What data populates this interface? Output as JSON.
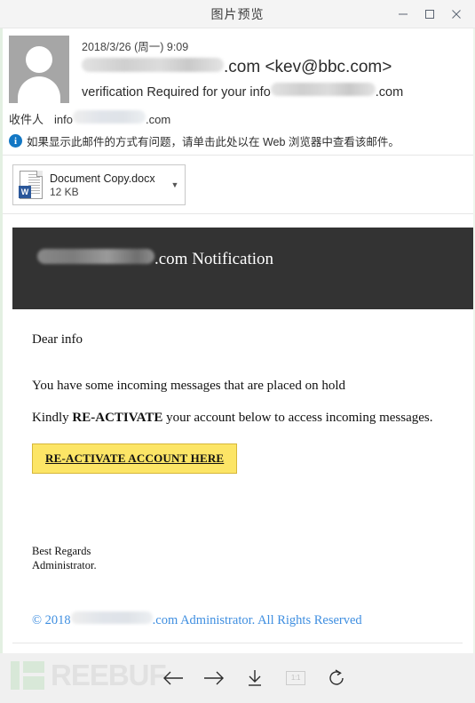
{
  "window": {
    "title": "图片预览",
    "controls": {
      "minimize": "minimize-icon",
      "maximize": "maximize-icon",
      "close": "close-icon"
    }
  },
  "mail": {
    "date": "2018/3/26 (周一) 9:09",
    "from_prefix": "",
    "from_suffix": ".com <kev@bbc.com>",
    "subject_prefix": "verification Required for your info",
    "subject_suffix": ".com",
    "to_label": "收件人",
    "to_prefix": "info",
    "to_suffix": ".com",
    "info_bar": "如果显示此邮件的方式有问题，请单击此处以在 Web 浏览器中查看该邮件。",
    "info_icon": "info-icon"
  },
  "attachment": {
    "name": "Document Copy.docx",
    "size": "12 KB",
    "icon": "word-document-icon",
    "badge": "W",
    "caret": "▼"
  },
  "email": {
    "banner_suffix": ".com Notification",
    "greeting": "Dear info",
    "paragraph_1": "You have some incoming messages that are placed on hold",
    "paragraph_2_before": "Kindly ",
    "paragraph_2_bold": "RE-ACTIVATE",
    "paragraph_2_after": " your account below to access incoming messages.",
    "cta_label": "RE-ACTIVATE ACCOUNT HERE",
    "signature_line_1": "Best Regards",
    "signature_line_2": "Administrator.",
    "footer_prefix": "© 2018 ",
    "footer_suffix": ".com Administrator. All Rights Reserved"
  },
  "toolbar": {
    "watermark_text": "REEBUF",
    "buttons": [
      {
        "name": "previous-image-button",
        "icon": "arrow-left-icon"
      },
      {
        "name": "next-image-button",
        "icon": "arrow-right-icon"
      },
      {
        "name": "download-button",
        "icon": "download-icon"
      },
      {
        "name": "actual-size-button",
        "icon": "one-to-one-icon",
        "label": "1:1"
      },
      {
        "name": "rotate-button",
        "icon": "rotate-icon"
      }
    ]
  },
  "colors": {
    "banner_bg": "#333333",
    "cta_bg": "#fce566",
    "cta_border": "#d6b73a",
    "footer_link": "#3e8ee0",
    "info_icon": "#1277c4",
    "word_badge": "#2b579a",
    "watermark_green": "#d8e8d8"
  }
}
